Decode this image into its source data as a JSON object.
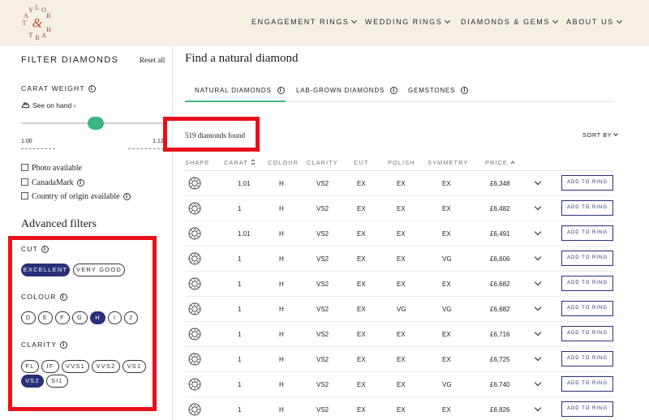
{
  "header": {
    "logo_letters": [
      "T",
      "A",
      "Y",
      "L",
      "O",
      "R",
      "H",
      "A",
      "R",
      "T"
    ],
    "nav": [
      {
        "label": "ENGAGEMENT RINGS"
      },
      {
        "label": "WEDDING RINGS"
      },
      {
        "label": "DIAMONDS & GEMS"
      },
      {
        "label": "ABOUT US"
      }
    ]
  },
  "colors": {
    "accent_green": "#3bb77e",
    "brand_navy": "#2a2f7a",
    "header_bg": "#f5efe6",
    "highlight_red": "#e8101a"
  },
  "sidebar": {
    "title": "FILTER DIAMONDS",
    "reset": "Reset all",
    "carat_label": "CARAT WEIGHT",
    "see_on_hand": "See on hand",
    "carat_min": "1.00",
    "carat_max": "1.12",
    "checkboxes": [
      {
        "label": "Photo available",
        "checked": false
      },
      {
        "label": "CanadaMark",
        "checked": false
      },
      {
        "label": "Country of origin available",
        "checked": false
      }
    ],
    "advanced_title": "Advanced filters",
    "cut": {
      "label": "CUT",
      "options": [
        "EXCELLENT",
        "VERY GOOD"
      ],
      "selected": [
        "EXCELLENT"
      ]
    },
    "colour": {
      "label": "COLOUR",
      "options": [
        "D",
        "E",
        "F",
        "G",
        "H",
        "I",
        "J"
      ],
      "selected": [
        "H"
      ]
    },
    "clarity": {
      "label": "CLARITY",
      "options": [
        "FL",
        "IF",
        "VVS1",
        "VVS2",
        "VS1",
        "VS2",
        "SI1"
      ],
      "selected": [
        "VS2"
      ]
    }
  },
  "main": {
    "title": "Find a natural diamond",
    "tabs": [
      {
        "label": "NATURAL DIAMONDS",
        "active": true
      },
      {
        "label": "LAB-GROWN DIAMONDS",
        "active": false
      },
      {
        "label": "GEMSTONES",
        "active": false
      }
    ],
    "results_count": "519 diamonds found",
    "sort_label": "SORT BY",
    "columns": [
      "SHAPE",
      "CARAT",
      "COLOUR",
      "CLARITY",
      "CUT",
      "POLISH",
      "SYMMETRY",
      "PRICE"
    ],
    "add_label": "ADD TO RING",
    "rows": [
      {
        "carat": "1.01",
        "colour": "H",
        "clarity": "VS2",
        "cut": "EX",
        "polish": "EX",
        "symmetry": "EX",
        "price": "£6,348"
      },
      {
        "carat": "1",
        "colour": "H",
        "clarity": "VS2",
        "cut": "EX",
        "polish": "EX",
        "symmetry": "EX",
        "price": "£6,482"
      },
      {
        "carat": "1.01",
        "colour": "H",
        "clarity": "VS2",
        "cut": "EX",
        "polish": "EX",
        "symmetry": "EX",
        "price": "£6,491"
      },
      {
        "carat": "1",
        "colour": "H",
        "clarity": "VS2",
        "cut": "EX",
        "polish": "EX",
        "symmetry": "VG",
        "price": "£6,606"
      },
      {
        "carat": "1",
        "colour": "H",
        "clarity": "VS2",
        "cut": "EX",
        "polish": "EX",
        "symmetry": "EX",
        "price": "£6,682"
      },
      {
        "carat": "1",
        "colour": "H",
        "clarity": "VS2",
        "cut": "EX",
        "polish": "VG",
        "symmetry": "VG",
        "price": "£6,682"
      },
      {
        "carat": "1",
        "colour": "H",
        "clarity": "VS2",
        "cut": "EX",
        "polish": "EX",
        "symmetry": "EX",
        "price": "£6,716"
      },
      {
        "carat": "1",
        "colour": "H",
        "clarity": "VS2",
        "cut": "EX",
        "polish": "EX",
        "symmetry": "EX",
        "price": "£6,725"
      },
      {
        "carat": "1",
        "colour": "H",
        "clarity": "VS2",
        "cut": "EX",
        "polish": "EX",
        "symmetry": "VG",
        "price": "£6,740"
      },
      {
        "carat": "1",
        "colour": "H",
        "clarity": "VS2",
        "cut": "EX",
        "polish": "EX",
        "symmetry": "EX",
        "price": "£6,826"
      }
    ]
  }
}
